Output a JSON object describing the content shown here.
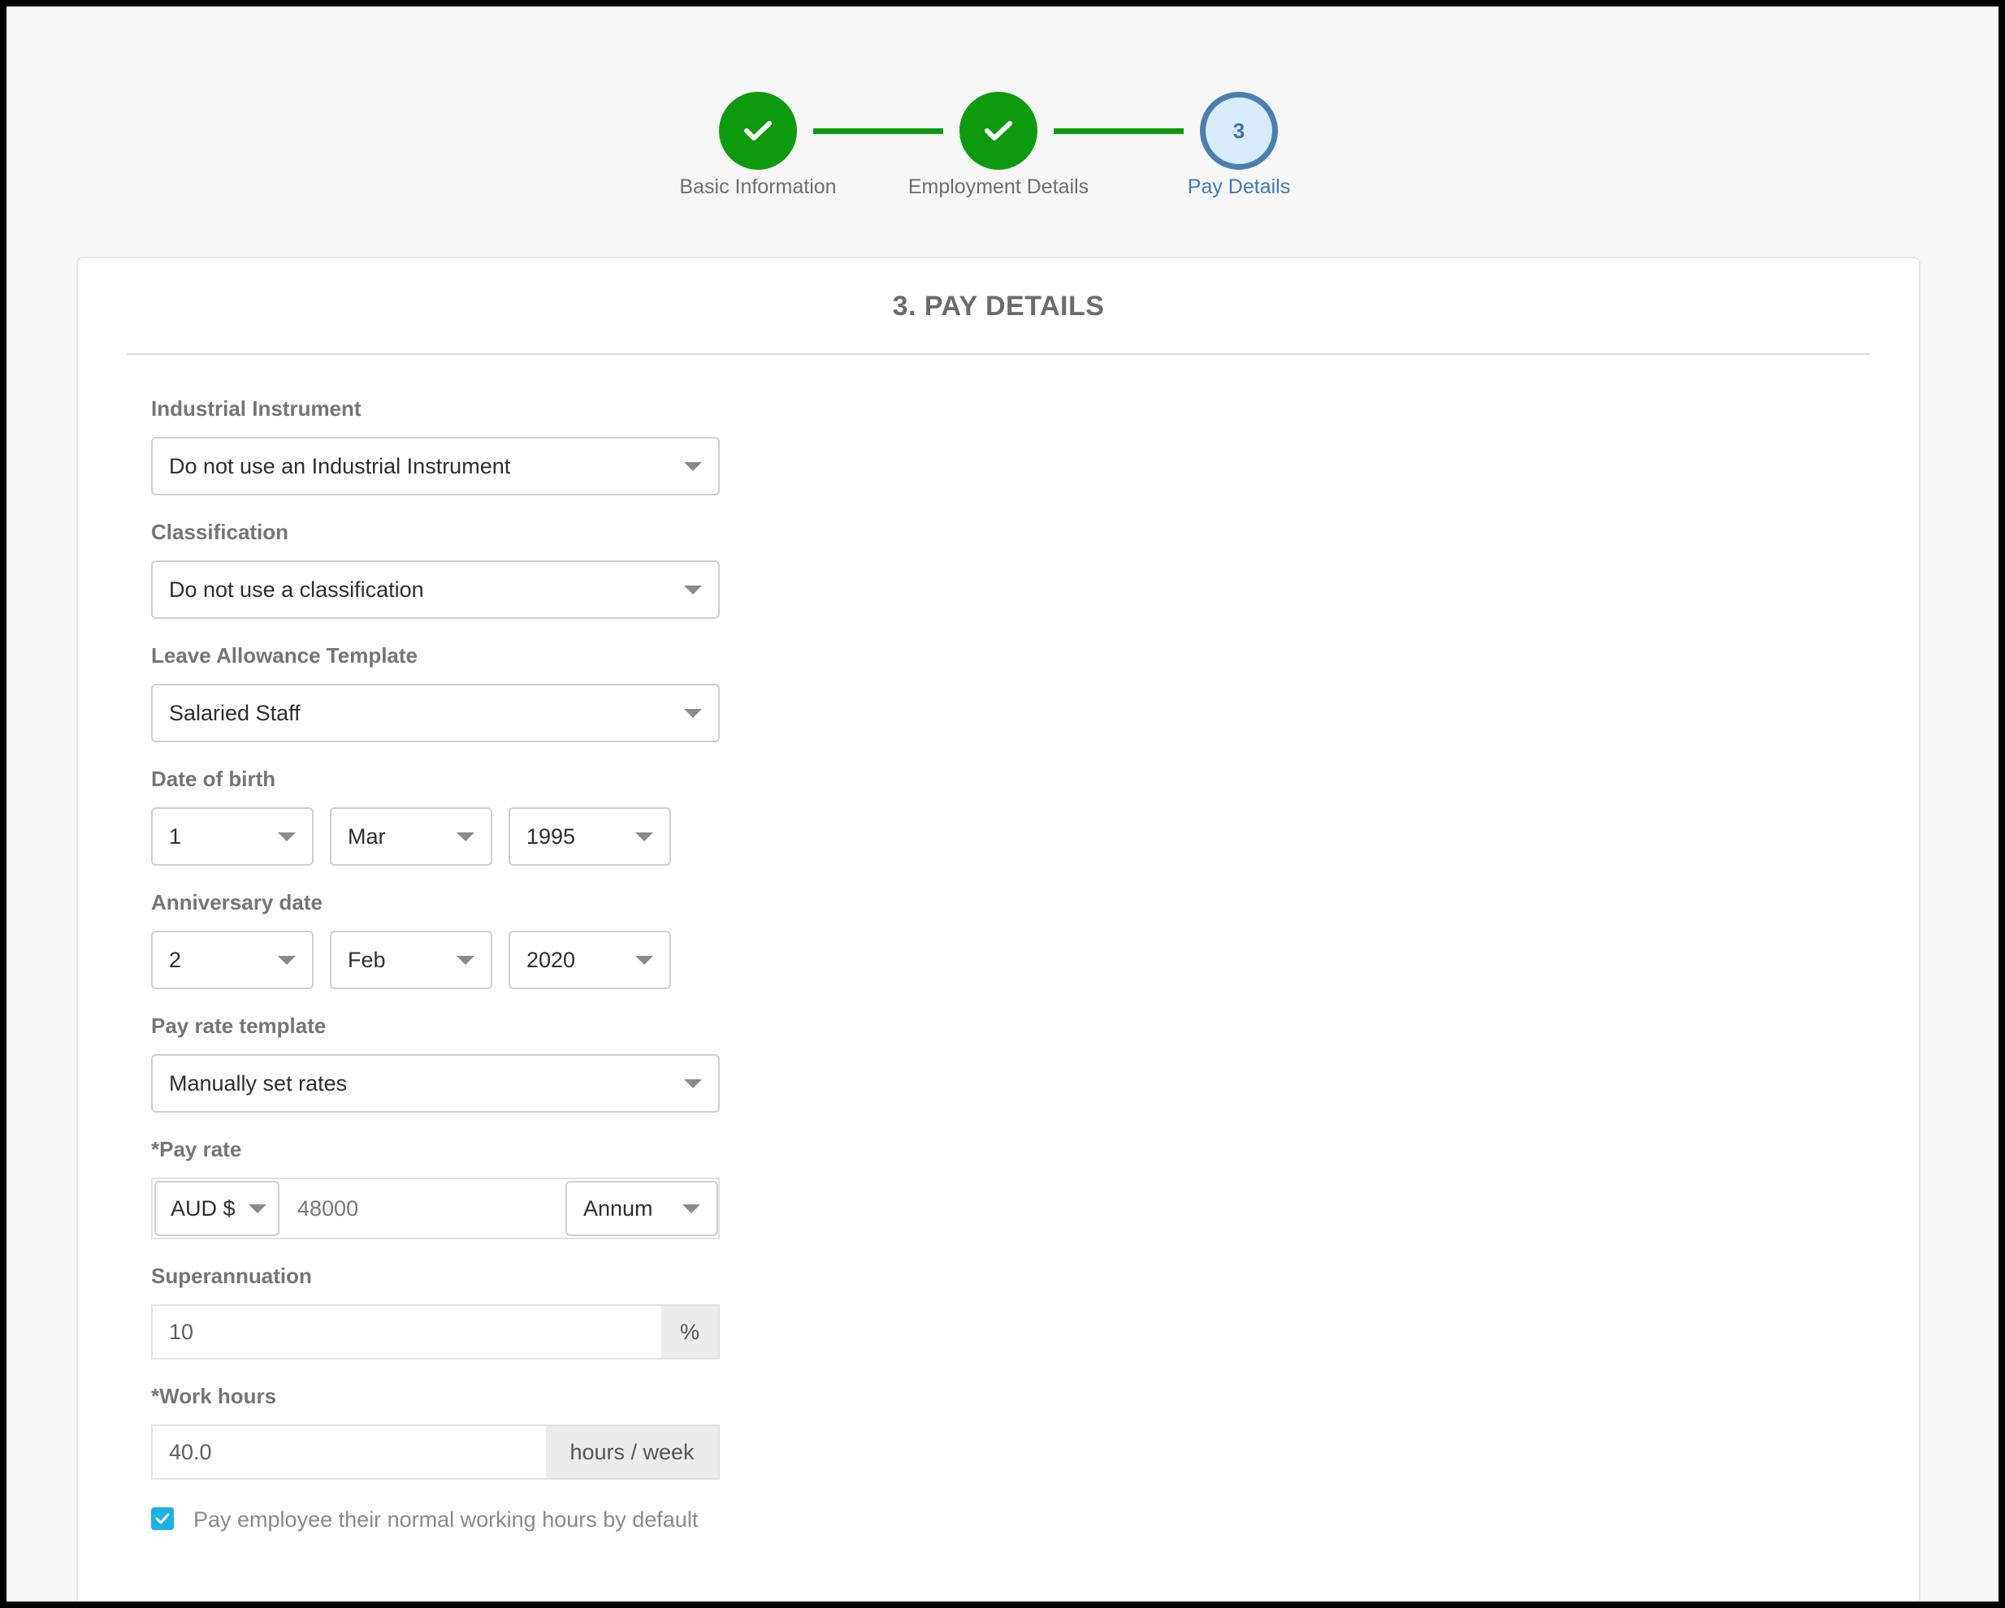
{
  "stepper": {
    "steps": [
      {
        "label": "Basic Information",
        "state": "done"
      },
      {
        "label": "Employment Details",
        "state": "done"
      },
      {
        "label": "Pay Details",
        "state": "current",
        "number": "3"
      }
    ]
  },
  "form": {
    "title": "3. PAY DETAILS",
    "industrial_instrument": {
      "label": "Industrial Instrument",
      "value": "Do not use an Industrial Instrument"
    },
    "classification": {
      "label": "Classification",
      "value": "Do not use a classification"
    },
    "leave_template": {
      "label": "Leave Allowance Template",
      "value": "Salaried Staff"
    },
    "date_of_birth": {
      "label": "Date of birth",
      "day": "1",
      "month": "Mar",
      "year": "1995"
    },
    "anniversary_date": {
      "label": "Anniversary date",
      "day": "2",
      "month": "Feb",
      "year": "2020"
    },
    "pay_rate_template": {
      "label": "Pay rate template",
      "value": "Manually set rates"
    },
    "pay_rate": {
      "label": "*Pay rate",
      "currency": "AUD $",
      "amount": "48000",
      "period": "Annum"
    },
    "superannuation": {
      "label": "Superannuation",
      "value": "10",
      "unit": "%"
    },
    "work_hours": {
      "label": "*Work hours",
      "value": "40.0",
      "unit": "hours / week"
    },
    "normal_hours_checkbox": {
      "label": "Pay employee their normal working hours by default",
      "checked": true
    }
  },
  "colors": {
    "done": "#0e9a0e",
    "current_ring": "#4a7fb0",
    "checkbox": "#1fb0e4"
  }
}
